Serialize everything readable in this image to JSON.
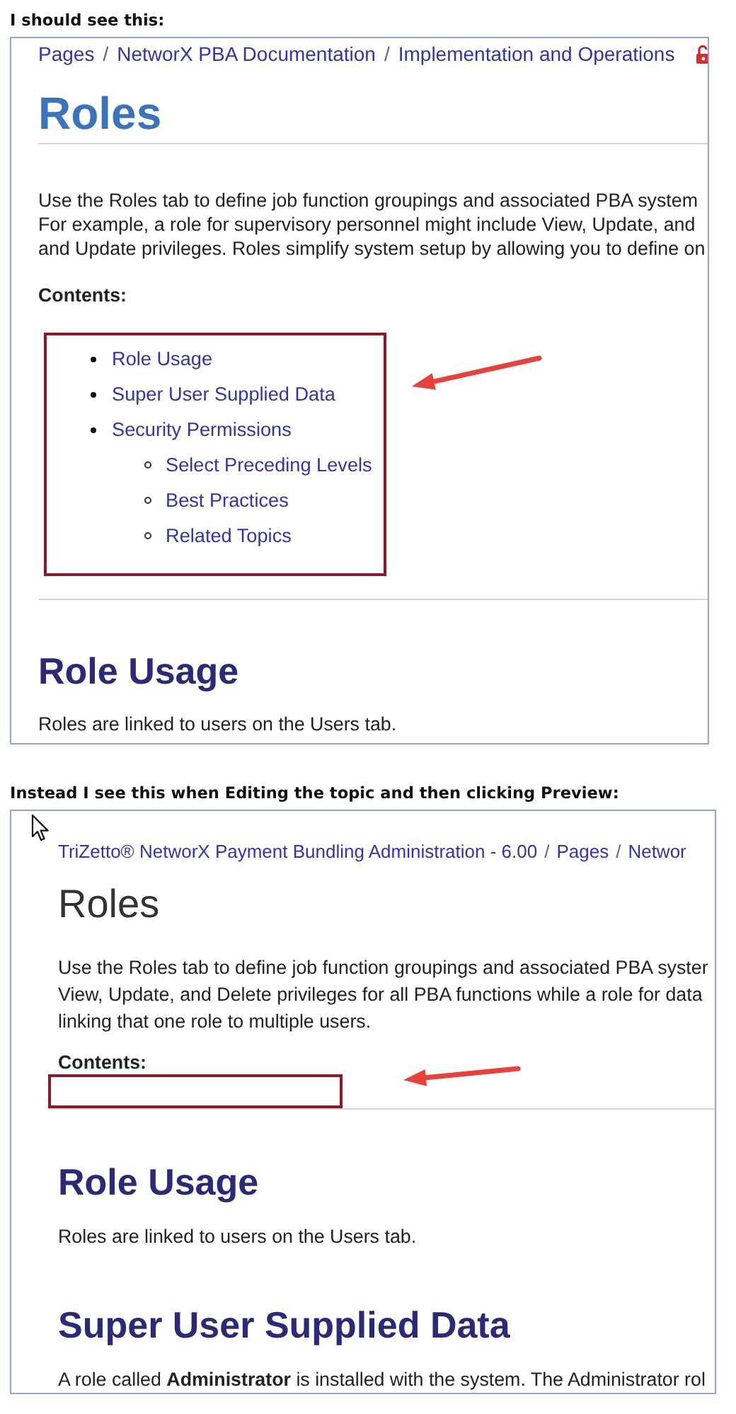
{
  "screens": [
    {
      "kind": "published",
      "caption": "I should see this:",
      "breadcrumb": {
        "separator": "/",
        "items": [
          "Pages",
          "NetworX PBA Documentation",
          "Implementation and Operations"
        ]
      },
      "title": "Roles",
      "paragraph": [
        "Use the Roles tab to define job function groupings and associated PBA system",
        "For example, a role for supervisory personnel might include View, Update, and",
        "and Update privileges. Roles simplify system setup by allowing you to define on"
      ],
      "contents_label": "Contents:",
      "contents": [
        {
          "label": "Role Usage"
        },
        {
          "label": "Super User Supplied Data"
        },
        {
          "label": "Security Permissions",
          "children": [
            {
              "label": "Select Preceding Levels"
            },
            {
              "label": "Best Practices"
            },
            {
              "label": "Related Topics"
            }
          ]
        }
      ],
      "sections": [
        {
          "heading": "Role Usage",
          "text": "Roles are linked to users on the Users tab."
        }
      ]
    },
    {
      "kind": "preview",
      "caption": "Instead I see this when Editing the topic and then clicking Preview:",
      "breadcrumb": {
        "separator": "/",
        "items": [
          "TriZetto® NetworX Payment Bundling Administration - 6.00",
          "Pages",
          "Networ"
        ]
      },
      "title": "Roles",
      "paragraph": [
        "Use the Roles tab to define job function groupings and associated PBA syster",
        "View, Update, and Delete privileges for all PBA functions while a role for data",
        "linking that one role to multiple users."
      ],
      "contents_label": "Contents:",
      "sections": [
        {
          "heading": "Role Usage",
          "text": "Roles are linked to users on the Users tab."
        },
        {
          "heading": "Super User Supplied Data",
          "text": "A role called **Administrator** is installed with the system. The Administrator rol"
        }
      ]
    }
  ]
}
